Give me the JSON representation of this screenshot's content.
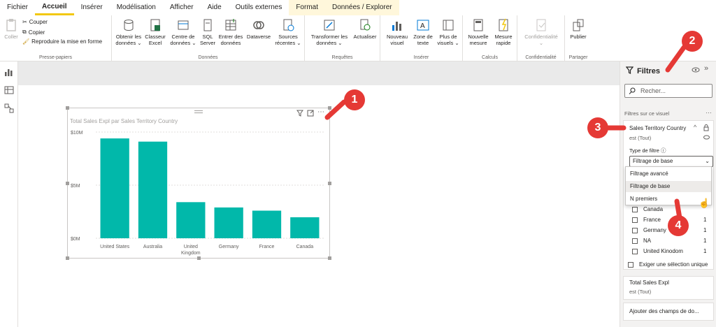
{
  "menu": [
    "Fichier",
    "Accueil",
    "Insérer",
    "Modélisation",
    "Afficher",
    "Aide",
    "Outils externes",
    "Format",
    "Données / Explorer"
  ],
  "ribbon": {
    "presse": {
      "label": "Presse-papiers",
      "coller": "Coller",
      "couper": "Couper",
      "copier": "Copier",
      "reproduire": "Reproduire la mise en forme"
    },
    "donnees": {
      "label": "Données",
      "obtenir": [
        "Obtenir les",
        "données ⌄"
      ],
      "classeur": [
        "Classeur",
        "Excel"
      ],
      "centre": [
        "Centre de",
        "données ⌄"
      ],
      "sql": [
        "SQL",
        "Server"
      ],
      "entrer": [
        "Entrer des",
        "données"
      ],
      "dataverse": [
        "Dataverse",
        ""
      ],
      "sources": [
        "Sources",
        "récentes ⌄"
      ]
    },
    "requetes": {
      "label": "Requêtes",
      "transformer": [
        "Transformer les",
        "données ⌄"
      ],
      "actualiser": [
        "Actualiser",
        ""
      ]
    },
    "inserer": {
      "label": "Insérer",
      "nouveau": [
        "Nouveau",
        "visuel"
      ],
      "zone": [
        "Zone de",
        "texte"
      ],
      "plus": [
        "Plus de",
        "visuels ⌄"
      ]
    },
    "calculs": {
      "label": "Calculs",
      "nouvelle": [
        "Nouvelle",
        "mesure"
      ],
      "rapide": [
        "Mesure",
        "rapide"
      ]
    },
    "confid": {
      "label": "Confidentialité",
      "conf": [
        "Confidentialité",
        "⌄"
      ]
    },
    "partager": {
      "label": "Partager",
      "publier": [
        "Publier",
        ""
      ]
    }
  },
  "visual": {
    "title": "Total Sales Expl par Sales Territory Country"
  },
  "chart_data": {
    "type": "bar",
    "categories": [
      "United States",
      "Australia",
      "United Kingdom",
      "Germany",
      "France",
      "Canada"
    ],
    "category_lines": [
      [
        "United States"
      ],
      [
        "Australia"
      ],
      [
        "United",
        "Kingdom"
      ],
      [
        "Germany"
      ],
      [
        "France"
      ],
      [
        "Canada"
      ]
    ],
    "values": [
      9.4,
      9.1,
      3.4,
      2.9,
      2.6,
      1.98
    ],
    "unit": "M",
    "ylim": [
      0,
      10
    ],
    "yticks": [
      "$0M",
      "$5M",
      "$10M"
    ],
    "title": "Total Sales Expl par Sales Territory Country",
    "bar_color": "#01B8AA",
    "grid": true
  },
  "filters": {
    "title": "Filtres",
    "search_placeholder": "Recher...",
    "section": "Filtres sur ce visuel",
    "card1_field": "Sales Territory Country",
    "card1_sub": "est (Tout)",
    "type_label": "Type de filtre ⓘ",
    "type_value": "Filtrage de base",
    "options": [
      "Filtrage avancé",
      "Filtrage de base",
      "N premiers"
    ],
    "list": [
      {
        "name": "Canada",
        "count": ""
      },
      {
        "name": "France",
        "count": "1"
      },
      {
        "name": "Germany",
        "count": "1"
      },
      {
        "name": "NA",
        "count": "1"
      },
      {
        "name": "United Kinodom",
        "count": "1"
      }
    ],
    "single": "Exiger une sélection unique",
    "card2_field": "Total Sales Expl",
    "card2_sub": "est (Tout)",
    "add": "Ajouter des champs de do..."
  },
  "badges": [
    "1",
    "2",
    "3",
    "4"
  ],
  "colors": {
    "accent": "#F2C811",
    "bar": "#01B8AA",
    "badge": "#E53935"
  }
}
